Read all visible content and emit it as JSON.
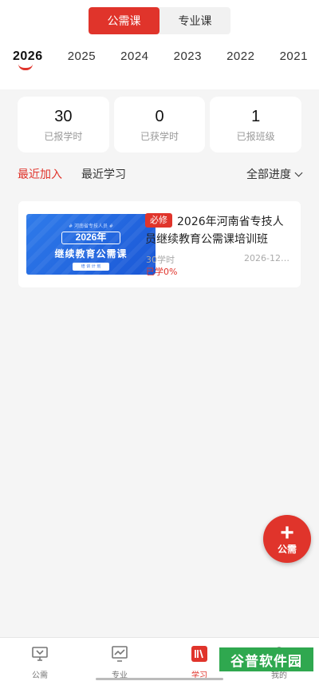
{
  "top_tabs": [
    {
      "label": "公需课",
      "active": true
    },
    {
      "label": "专业课",
      "active": false
    }
  ],
  "years": [
    "2026",
    "2025",
    "2024",
    "2023",
    "2022",
    "2021"
  ],
  "selected_year": "2026",
  "stats": [
    {
      "value": "30",
      "label": "已报学时"
    },
    {
      "value": "0",
      "label": "已获学时"
    },
    {
      "value": "1",
      "label": "已报班级"
    }
  ],
  "filters": {
    "recent_added": "最近加入",
    "recent_study": "最近学习",
    "progress": "全部进度"
  },
  "course": {
    "thumb_top": "# 河南省专技人员 #",
    "thumb_year": "2026年",
    "thumb_title": "继续教育公需课",
    "thumb_bottom": "培 训 计 划",
    "badge": "必修",
    "title": "2026年河南省专技人员继续教育公需课培训班",
    "hours": "30学时",
    "date": "2026-12…",
    "progress": "已学0%"
  },
  "fab": {
    "plus": "+",
    "label": "公需"
  },
  "tabbar": [
    {
      "label": "公需",
      "icon": "monitor-icon",
      "active": false
    },
    {
      "label": "专业",
      "icon": "chart-monitor-icon",
      "active": false
    },
    {
      "label": "学习",
      "icon": "books-icon",
      "active": true
    },
    {
      "label": "我的",
      "icon": "user-icon",
      "active": false
    }
  ],
  "watermark": "谷普软件园",
  "colors": {
    "accent": "#e0342b",
    "watermark_bg": "#2fa84f",
    "thumb_blue": "#2f7bea"
  }
}
